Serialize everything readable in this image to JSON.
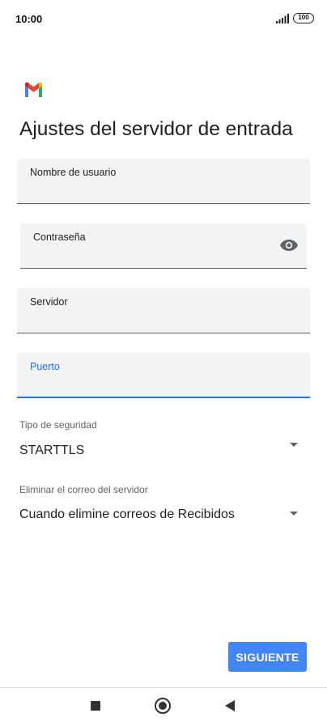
{
  "status_bar": {
    "time": "10:00",
    "battery": "100",
    "signal_icon": "signal-bars-icon"
  },
  "app": {
    "logo_icon": "gmail-logo-icon",
    "colors": {
      "accent": "#1a73e8",
      "button": "#4285f4",
      "field_bg": "#f1f3f4"
    }
  },
  "page": {
    "title": "Ajustes del servidor de entrada"
  },
  "fields": {
    "username": {
      "label": "Nombre de usuario",
      "value": ""
    },
    "password": {
      "label": "Contraseña",
      "value": "",
      "toggle_icon": "eye-icon"
    },
    "server": {
      "label": "Servidor",
      "value": ""
    },
    "port": {
      "label": "Puerto",
      "value": ""
    }
  },
  "security": {
    "label": "Tipo de seguridad",
    "selected": "STARTTLS"
  },
  "delete_mail": {
    "label": "Eliminar el correo del servidor",
    "selected": "Cuando elimine correos de Recibidos"
  },
  "actions": {
    "next_label": "SIGUIENTE"
  },
  "nav_bar": {
    "recents_icon": "square-icon",
    "home_icon": "circle-icon",
    "back_icon": "back-triangle-icon"
  }
}
